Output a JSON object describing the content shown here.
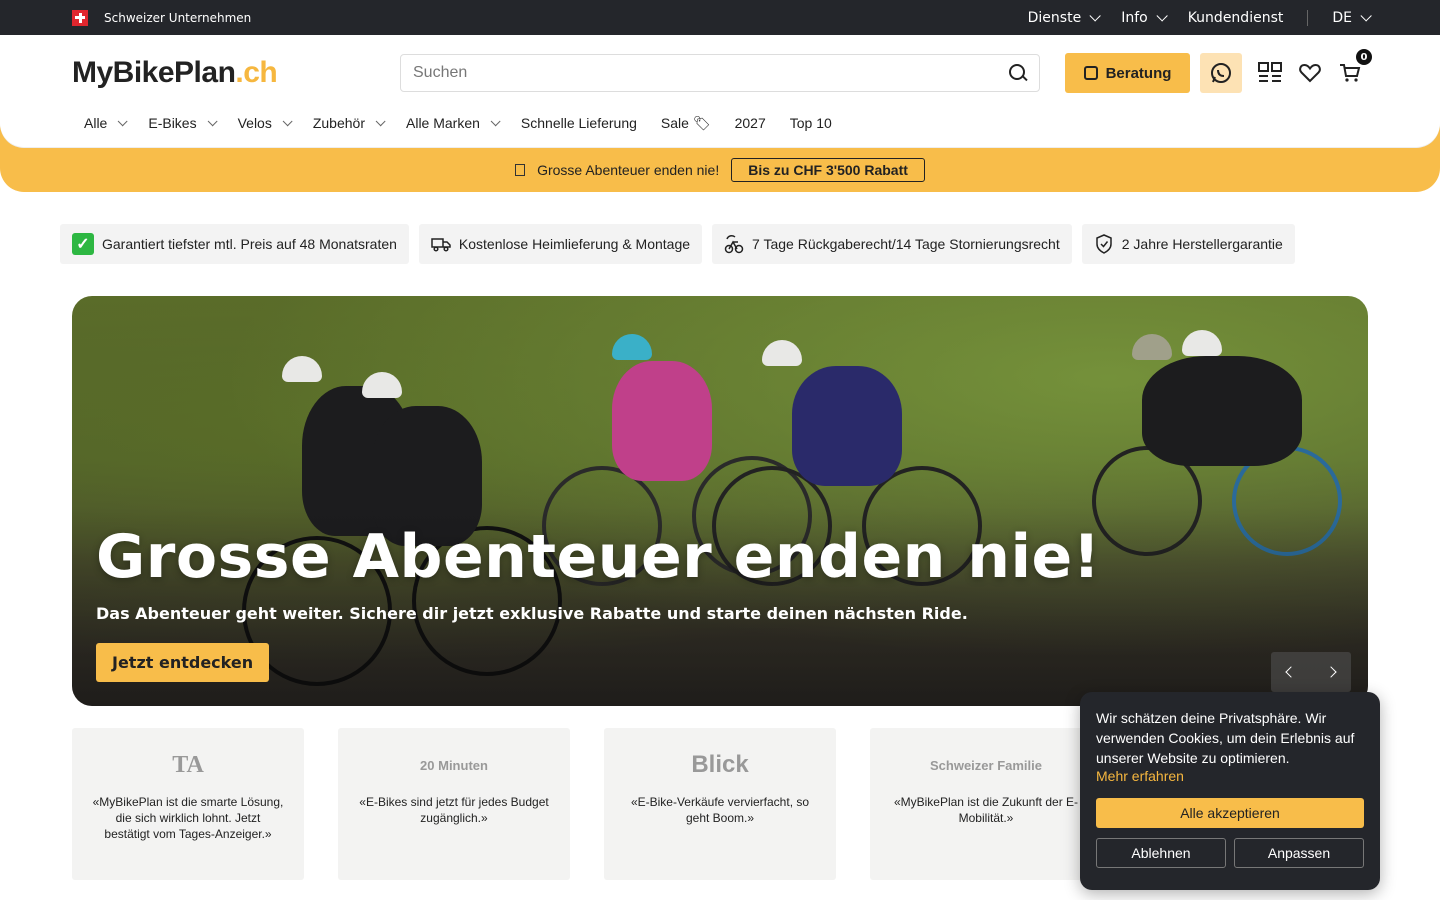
{
  "topbar": {
    "company_label": "Schweizer Unternehmen",
    "menu": [
      "Dienste",
      "Info"
    ],
    "service": "Kundendienst",
    "language": "DE"
  },
  "header": {
    "logo_main": "MyBikePlan",
    "logo_suffix": ".ch",
    "search_placeholder": "Suchen",
    "beratung_label": "Beratung",
    "cart_count": "0"
  },
  "nav": {
    "items": [
      {
        "label": "Alle",
        "dropdown": true
      },
      {
        "label": "E-Bikes",
        "dropdown": true
      },
      {
        "label": "Velos",
        "dropdown": true
      },
      {
        "label": "Zubehör",
        "dropdown": true
      },
      {
        "label": "Alle Marken",
        "dropdown": true
      },
      {
        "label": "Schnelle Lieferung",
        "dropdown": false
      },
      {
        "label": "Sale 🏷",
        "dropdown": false
      },
      {
        "label": "2027",
        "dropdown": false
      },
      {
        "label": "Top 10",
        "dropdown": false
      }
    ]
  },
  "promo": {
    "text": "Grosse Abenteuer enden nie!",
    "button": "Bis zu CHF 3'500 Rabatt"
  },
  "usps": [
    {
      "icon": "check-icon",
      "label": "Garantiert tiefster mtl. Preis auf 48 Monatsraten"
    },
    {
      "icon": "truck-icon",
      "label": "Kostenlose Heimlieferung & Montage"
    },
    {
      "icon": "bike-return-icon",
      "label": "7 Tage Rückgaberecht/14 Tage Stornierungsrecht"
    },
    {
      "icon": "shield-check-icon",
      "label": "2 Jahre Herstellergarantie"
    }
  ],
  "hero": {
    "title": "Grosse Abenteuer enden nie!",
    "subtitle": "Das Abenteuer geht weiter. Sichere dir jetzt exklusive Rabatte und starte deinen nächsten Ride.",
    "cta": "Jetzt entdecken"
  },
  "press": [
    {
      "logo": "TA",
      "quote": "«MyBikePlan ist die smarte Lösung, die sich wirklich lohnt. Jetzt bestätigt vom Tages-Anzeiger.»"
    },
    {
      "logo": "20 Minuten",
      "quote": "«E-Bikes sind jetzt für jedes Budget zugänglich.»"
    },
    {
      "logo": "Blick",
      "quote": "«E-Bike-Verkäufe vervierfacht, so geht Boom.»"
    },
    {
      "logo": "Schweizer Familie",
      "quote": "«MyBikePlan ist die Zukunft der E-Mobilität.»"
    }
  ],
  "cookie": {
    "text": "Wir schätzen deine Privatsphäre. Wir verwenden Cookies, um dein Erlebnis auf unserer Website zu optimieren.",
    "link": "Mehr erfahren",
    "accept": "Alle akzeptieren",
    "decline": "Ablehnen",
    "customize": "Anpassen"
  },
  "colors": {
    "accent": "#f8bd4a",
    "dark": "#24262b",
    "brand_suffix": "#f6b73f"
  }
}
